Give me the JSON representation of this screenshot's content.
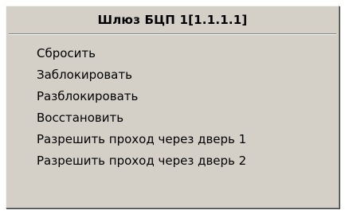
{
  "menu": {
    "title": "Шлюз БЦП 1[1.1.1.1]",
    "items": [
      {
        "label": "Сбросить"
      },
      {
        "label": "Заблокировать"
      },
      {
        "label": "Разблокировать"
      },
      {
        "label": "Восстановить"
      },
      {
        "label": "Разрешить проход через дверь 1"
      },
      {
        "label": "Разрешить проход через дверь 2"
      }
    ]
  }
}
